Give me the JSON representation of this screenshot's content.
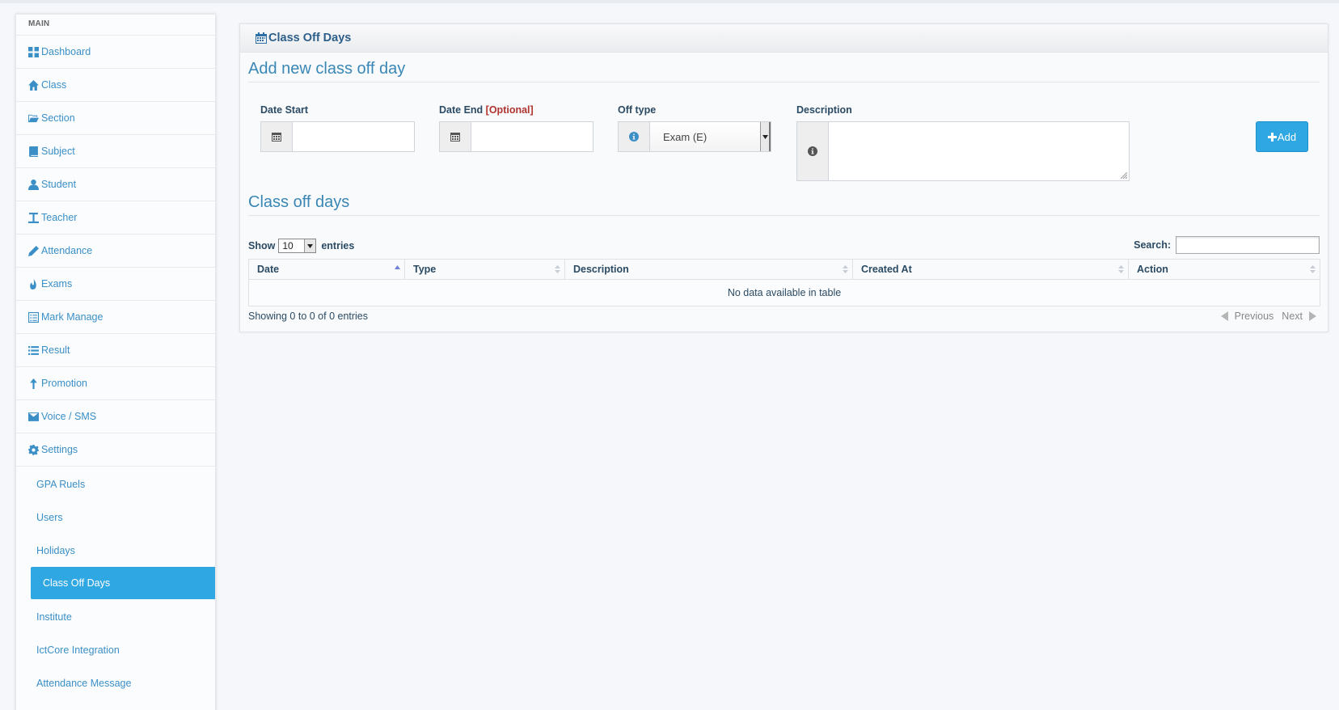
{
  "sidebar": {
    "header": "MAIN",
    "items": [
      {
        "label": "Dashboard",
        "icon": "dashboard-icon"
      },
      {
        "label": "Class",
        "icon": "home-icon"
      },
      {
        "label": "Section",
        "icon": "folder-open-icon"
      },
      {
        "label": "Subject",
        "icon": "book-icon"
      },
      {
        "label": "Student",
        "icon": "user-icon"
      },
      {
        "label": "Teacher",
        "icon": "text-cursor-icon"
      },
      {
        "label": "Attendance",
        "icon": "pencil-icon"
      },
      {
        "label": "Exams",
        "icon": "fire-icon"
      },
      {
        "label": "Mark Manage",
        "icon": "list-alt-icon"
      },
      {
        "label": "Result",
        "icon": "list-icon"
      },
      {
        "label": "Promotion",
        "icon": "arrow-up-icon"
      },
      {
        "label": "Voice / SMS",
        "icon": "envelope-icon"
      },
      {
        "label": "Settings",
        "icon": "gear-icon"
      }
    ],
    "settings_sub": [
      {
        "label": "GPA Ruels"
      },
      {
        "label": "Users"
      },
      {
        "label": "Holidays"
      },
      {
        "label": "Class Off Days",
        "active": true
      },
      {
        "label": "Institute"
      },
      {
        "label": "IctCore Integration"
      },
      {
        "label": "Attendance Message"
      }
    ]
  },
  "panel": {
    "title": "Class Off Days",
    "form_title": "Add new class off day",
    "date_start_label": "Date Start",
    "date_end_label": "Date End",
    "date_end_optional": "[Optional]",
    "off_type_label": "Off type",
    "off_type_value": "Exam (E)",
    "description_label": "Description",
    "add_button": "Add",
    "list_title": "Class off days"
  },
  "table": {
    "show_label": "Show",
    "entries_label": "entries",
    "page_length": "10",
    "search_label": "Search:",
    "columns": [
      "Date",
      "Type",
      "Description",
      "Created At",
      "Action"
    ],
    "empty_message": "No data available in table",
    "info": "Showing 0 to 0 of 0 entries",
    "previous": "Previous",
    "next": "Next"
  },
  "colors": {
    "accent": "#2fa7e3",
    "link": "#3a8fc7",
    "heading": "#3a87b5",
    "optional": "#b0342f"
  }
}
